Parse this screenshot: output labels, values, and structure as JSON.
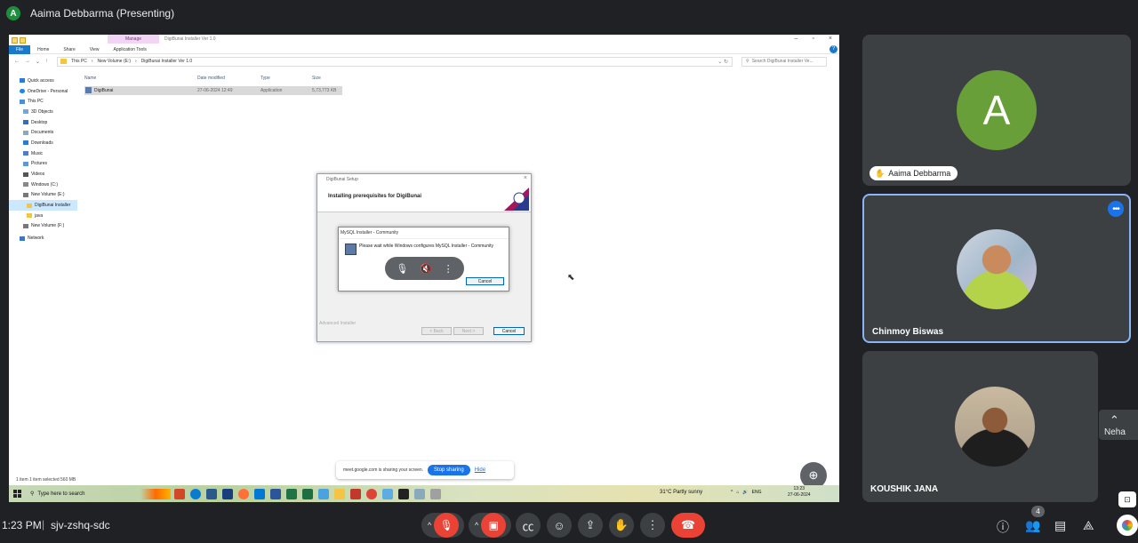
{
  "presenter": {
    "avatar_letter": "A",
    "title": "Aaima Debbarma (Presenting)"
  },
  "explorer": {
    "manage_tab": "Manage",
    "window_title": "DigiBunai Installer Ver 1.0",
    "ribbon_tabs": [
      "File",
      "Home",
      "Share",
      "View",
      "Application Tools"
    ],
    "breadcrumb": [
      "This PC",
      "New Volume (E:)",
      "DigiBunai Installer Ver 1.0"
    ],
    "search_placeholder": "Search DigiBunai Installer Ve...",
    "nav_items": [
      "Quick access",
      "OneDrive - Personal",
      "This PC",
      "3D Objects",
      "Desktop",
      "Documents",
      "Downloads",
      "Music",
      "Pictures",
      "Videos",
      "Windows (C:)",
      "New Volume (E:)",
      "DigiBunai Installer",
      "java",
      "New Volume (F:)",
      "Network"
    ],
    "columns": [
      "Name",
      "Date modified",
      "Type",
      "Size"
    ],
    "file": {
      "name": "DigiBunai",
      "date": "27-06-2024 12:49",
      "type": "Application",
      "size": "5,73,773 KB"
    },
    "status": "1 item    1 item selected  560 MB"
  },
  "setup_dialog": {
    "title": "DigiBunai Setup",
    "heading": "Installing prerequisites for DigiBunai",
    "footer": "Advanced Installer",
    "back": "< Back",
    "next": "Next >",
    "cancel": "Cancel"
  },
  "mysql_dialog": {
    "title": "MySQL Installer - Community",
    "message": "Please wait while Windows configures MySQL Installer - Community",
    "cancel": "Cancel"
  },
  "share_banner": {
    "text": "meet.google.com is sharing your screen.",
    "stop": "Stop sharing",
    "hide": "Hide"
  },
  "taskbar": {
    "search": "Type here to search",
    "weather": "31°C  Partly sunny",
    "lang": "ENG",
    "time": "13:23",
    "date": "27-06-2024"
  },
  "participants": {
    "p1": {
      "letter": "A",
      "name": "Aaima Debbarma"
    },
    "p2": {
      "name": "Chinmoy Biswas"
    },
    "p3": {
      "name": "KOUSHIK JANA"
    },
    "side": "Neha"
  },
  "meeting": {
    "time": "1:23 PM",
    "code": "sjv-zshq-sdc",
    "people_count": "4"
  },
  "colors": {
    "end_call": "#ea4335",
    "active_tile": "#8ab4f8",
    "stop_sharing": "#1a73e8"
  }
}
